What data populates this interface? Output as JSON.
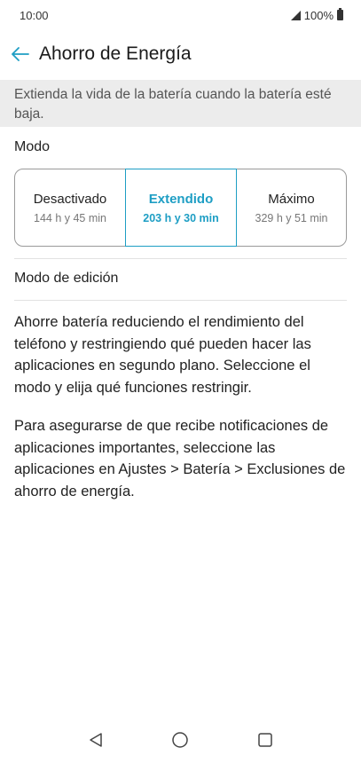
{
  "status": {
    "time": "10:00",
    "battery": "100%"
  },
  "header": {
    "title": "Ahorro de Energía"
  },
  "banner": {
    "text": "Extienda la vida de la batería cuando la batería esté baja."
  },
  "modes": {
    "section_title": "Modo",
    "options": [
      {
        "label": "Desactivado",
        "sub": "144 h y 45 min"
      },
      {
        "label": "Extendido",
        "sub": "203 h y 30 min"
      },
      {
        "label": "Máximo",
        "sub": "329 h y 51 min"
      }
    ],
    "selected": "Extendido"
  },
  "edit_mode": {
    "label": "Modo de edición"
  },
  "description": {
    "p1": "Ahorre batería reduciendo el rendimiento del teléfono y restringiendo qué pueden hacer las aplicaciones en segundo plano. Seleccione el modo y elija qué funciones restringir.",
    "p2": "Para asegurarse de que recibe notificaciones de aplicaciones importantes, seleccione las aplicaciones en Ajustes > Batería > Exclusiones de ahorro de energía."
  },
  "colors": {
    "accent": "#1e9ec4"
  },
  "icons": {
    "back": "arrow-left-icon",
    "nav": [
      "back-triangle-icon",
      "home-circle-icon",
      "recents-square-icon"
    ]
  }
}
